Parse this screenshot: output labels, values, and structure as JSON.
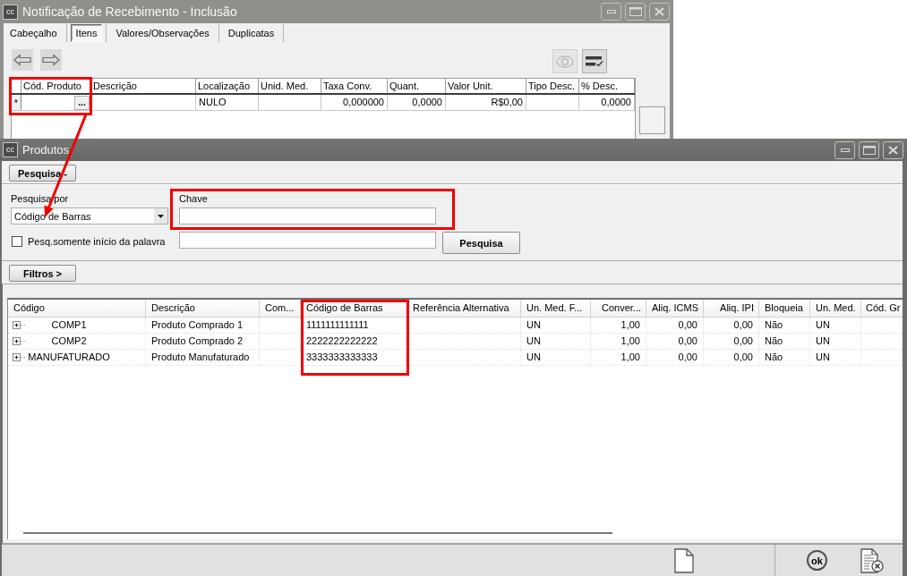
{
  "receipt_window": {
    "icon_label": "cc",
    "title": "Notificação de Recebimento - Inclusão",
    "tabs": [
      {
        "label": "Cabeçalho",
        "selected": false
      },
      {
        "label": "Itens",
        "selected": true
      },
      {
        "label": "Valores/Observações",
        "selected": false
      },
      {
        "label": "Duplicatas",
        "selected": false
      }
    ],
    "view_button": {
      "disabled": true
    },
    "grid": {
      "columns": [
        "Cód. Produto",
        "Descrição",
        "Localização",
        "Unid. Med.",
        "Taxa Conv.",
        "Quant.",
        "Valor Unit.",
        "Tipo Desc.",
        "% Desc."
      ],
      "rows": [
        {
          "marker": "*",
          "lookup_button": "...",
          "cells": [
            null,
            null,
            "NULO",
            null,
            "0,000000",
            "0,0000",
            "R$0,00",
            null,
            "0,0000"
          ]
        }
      ]
    }
  },
  "products_window": {
    "icon_label": "cc",
    "title": "Produtos",
    "search_toggle": "Pesquisa -",
    "search_by": {
      "label": "Pesquisa por",
      "value": "Código de Barras"
    },
    "key_field": {
      "label": "Chave"
    },
    "starts_with_only": {
      "label": "Pesq.somente início da palavra",
      "checked": false
    },
    "search_button": "Pesquisa",
    "filters_toggle": "Filtros >",
    "table": {
      "columns": [
        "Código",
        "Descrição",
        "Com...",
        "Código de Barras",
        "Referência Alternativa",
        "Un. Med. F...",
        "Conver...",
        "Aliq. ICMS",
        "Aliq. IPI",
        "Bloqueia",
        "Un. Med.",
        "Cód. Gr"
      ],
      "rows": [
        {
          "expanded": false,
          "cells": [
            "COMP1",
            "Produto Comprado 1",
            null,
            "1111111111111",
            null,
            "UN",
            "1,00",
            "0,00",
            "0,00",
            "Não",
            "UN",
            null
          ]
        },
        {
          "expanded": false,
          "cells": [
            "COMP2",
            "Produto Comprado 2",
            null,
            "2222222222222",
            null,
            "UN",
            "1,00",
            "0,00",
            "0,00",
            "Não",
            "UN",
            null
          ]
        },
        {
          "expanded": false,
          "cells": [
            "MANUFATURADO",
            "Produto Manufaturado",
            null,
            "3333333333333",
            null,
            "UN",
            "1,00",
            "0,00",
            "0,00",
            "Não",
            "UN",
            null
          ]
        }
      ]
    },
    "confirm_button": "ok"
  }
}
